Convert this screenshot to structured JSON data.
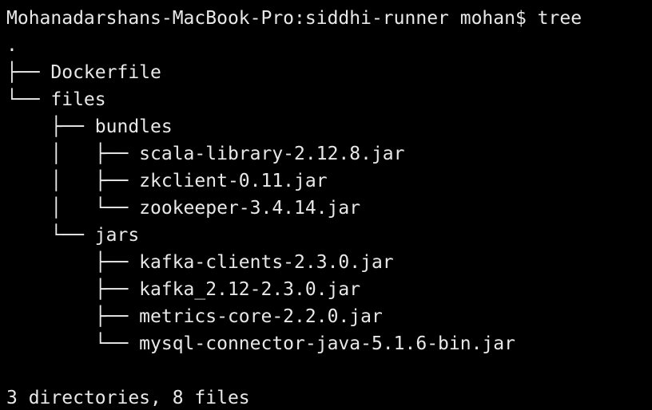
{
  "terminal": {
    "prompt": "Mohanadarshans-MacBook-Pro:siddhi-runner mohan$ tree",
    "tree_lines": [
      {
        "prefix": "",
        "name": "."
      },
      {
        "prefix": "├── ",
        "name": "Dockerfile"
      },
      {
        "prefix": "└── ",
        "name": "files"
      },
      {
        "prefix": "    ├── ",
        "name": "bundles"
      },
      {
        "prefix": "    │   ├── ",
        "name": "scala-library-2.12.8.jar"
      },
      {
        "prefix": "    │   ├── ",
        "name": "zkclient-0.11.jar"
      },
      {
        "prefix": "    │   └── ",
        "name": "zookeeper-3.4.14.jar"
      },
      {
        "prefix": "    └── ",
        "name": "jars"
      },
      {
        "prefix": "        ├── ",
        "name": "kafka-clients-2.3.0.jar"
      },
      {
        "prefix": "        ├── ",
        "name": "kafka_2.12-2.3.0.jar"
      },
      {
        "prefix": "        ├── ",
        "name": "metrics-core-2.2.0.jar"
      },
      {
        "prefix": "        └── ",
        "name": "mysql-connector-java-5.1.6-bin.jar"
      }
    ],
    "summary": "3 directories, 8 files",
    "colors": {
      "background": "#000000",
      "text": "#e8e8e8"
    }
  }
}
